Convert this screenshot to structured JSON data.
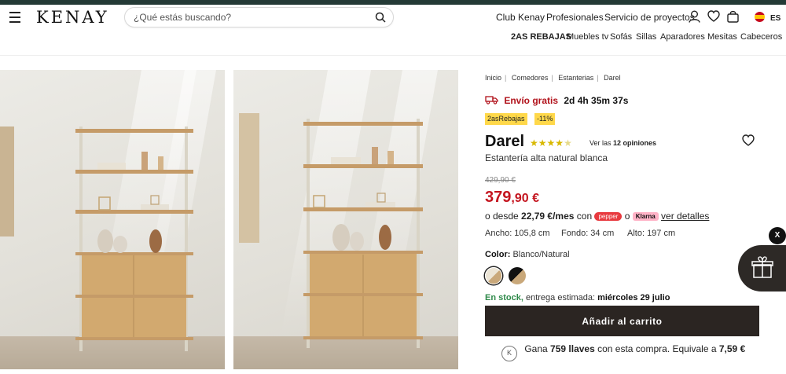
{
  "header": {
    "logo": "KENAY",
    "search_placeholder": "¿Qué estás buscando?",
    "links": [
      "Club Kenay",
      "Profesionales",
      "Servicio de proyectos"
    ],
    "lang": "ES"
  },
  "categories": [
    "2AS REBAJAS",
    "Muebles tv",
    "Sofás",
    "Sillas",
    "Aparadores",
    "Mesitas",
    "Cabeceros"
  ],
  "breadcrumb": [
    "Inicio",
    "Comedores",
    "Estanterias",
    "Darel"
  ],
  "shipping": {
    "label": "Envío gratis",
    "timer": "2d 4h 35m 37s"
  },
  "badges": {
    "campaign": "2asRebajas",
    "discount": "-11%"
  },
  "product": {
    "name": "Darel",
    "subtitle": "Estantería alta natural blanca",
    "rating": 4.5,
    "reviews_prefix": "Ver las",
    "reviews_count": "12 opiniones",
    "old_price": "429,90 €",
    "price_int": "379",
    "price_dec": ",90 €"
  },
  "financing": {
    "prefix": "o desde",
    "amount": "22,79 €/mes",
    "con": "con",
    "pepper": "pepper",
    "o": "o",
    "klarna": "Klarna",
    "details": "ver detalles"
  },
  "dimensions": {
    "ancho": "Ancho: 105,8 cm",
    "fondo": "Fondo: 34 cm",
    "alto": "Alto: 197 cm"
  },
  "color": {
    "label": "Color:",
    "value": "Blanco/Natural"
  },
  "stock": {
    "status": "En stock,",
    "text": "entrega estimada:",
    "date": "miércoles 29 julio"
  },
  "cart_button": "Añadir al carrito",
  "points": {
    "prefix": "Gana",
    "amount": "759 llaves",
    "middle": "con esta compra. Equivale a",
    "value": "7,59 €"
  },
  "widget_close": "X",
  "colors": {
    "accent_red": "#c4151f",
    "cart_bg": "#2b2522",
    "badge_yellow": "#ffd84a",
    "stock_green": "#2f8a4a"
  }
}
